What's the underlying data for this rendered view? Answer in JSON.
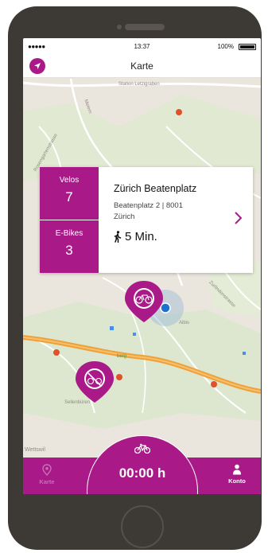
{
  "statusbar": {
    "carrier": "●●●●● ",
    "time": "13:37",
    "battery_pct": "100%"
  },
  "navbar": {
    "title": "Karte",
    "locate_icon": "location-arrow-icon"
  },
  "map": {
    "labels": {
      "top_street": "Station Letzigraben",
      "upper_left": "Meiern",
      "left_road": "Rosengartenstrasse",
      "right_road": "Zurlindenstrasse",
      "near_pin": "Albis",
      "middle_street": "berg",
      "lower_area": "Sellenbüren",
      "bottom_left": "Wettswil"
    }
  },
  "station_card": {
    "velos_label": "Velos",
    "velos_count": "7",
    "ebikes_label": "E-Bikes",
    "ebikes_count": "3",
    "name": "Zürich Beatenplatz",
    "address": "Beatenplatz 2 | 8001",
    "city": "Zürich",
    "walk_time": "5 Min."
  },
  "tabbar": {
    "karte_label": "Karte",
    "timer": "00:00 h",
    "konto_label": "Konto"
  },
  "colors": {
    "accent": "#a91a88",
    "map_background": "#ebe6dd",
    "road_orange": "#f0a038",
    "user_location": "#1f6fd1"
  }
}
